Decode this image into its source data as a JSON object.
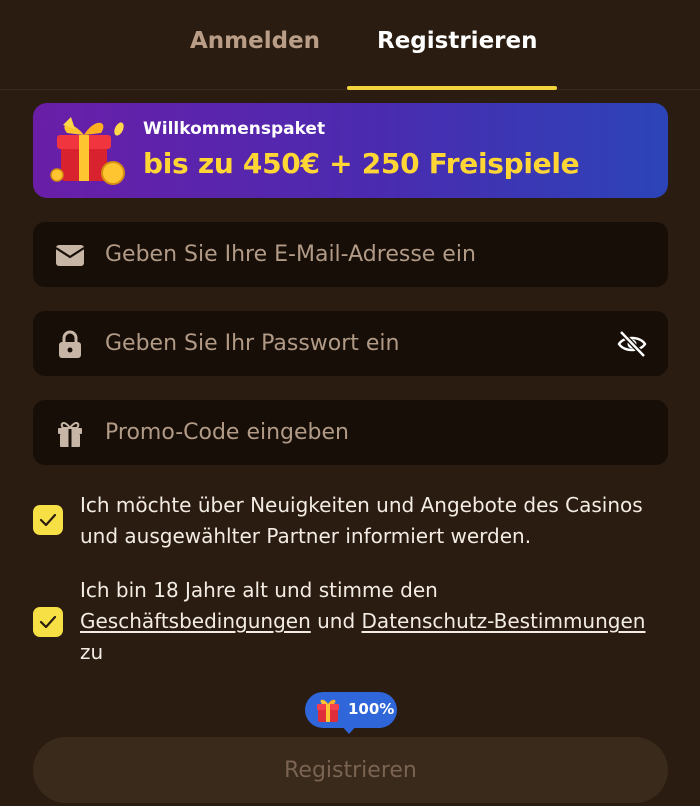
{
  "tabs": {
    "login": "Anmelden",
    "register": "Registrieren"
  },
  "banner": {
    "subtitle": "Willkommenspaket",
    "title": "bis zu 450€ + 250 Freispiele"
  },
  "form": {
    "email_placeholder": "Geben Sie Ihre E-Mail-Adresse ein",
    "password_placeholder": "Geben Sie Ihr Passwort ein",
    "promo_placeholder": "Promo-Code eingeben"
  },
  "consents": {
    "newsletter": "Ich möchte über Neuigkeiten und Angebote des Casinos und ausgewählter Partner informiert werden.",
    "terms_prefix": "Ich bin 18 Jahre alt und stimme den",
    "terms_link": "Geschäftsbedingungen",
    "terms_and": "und",
    "privacy_link": "Datenschutz-Bestimmungen",
    "terms_suffix": "zu"
  },
  "bonus_badge": {
    "value": "100%"
  },
  "submit_label": "Registrieren",
  "colors": {
    "background": "#2a1c10",
    "accent_yellow": "#f2d33e",
    "banner_purple": "#6a1ea8",
    "banner_blue": "#2c44b8",
    "badge_blue": "#2f66d9"
  },
  "icons": {
    "email": "envelope-icon",
    "password": "lock-icon",
    "toggle_visibility": "eye-slash-icon",
    "promo": "gift-icon",
    "banner": "gift-box-coins-icon",
    "checkbox": "checkmark-icon"
  }
}
